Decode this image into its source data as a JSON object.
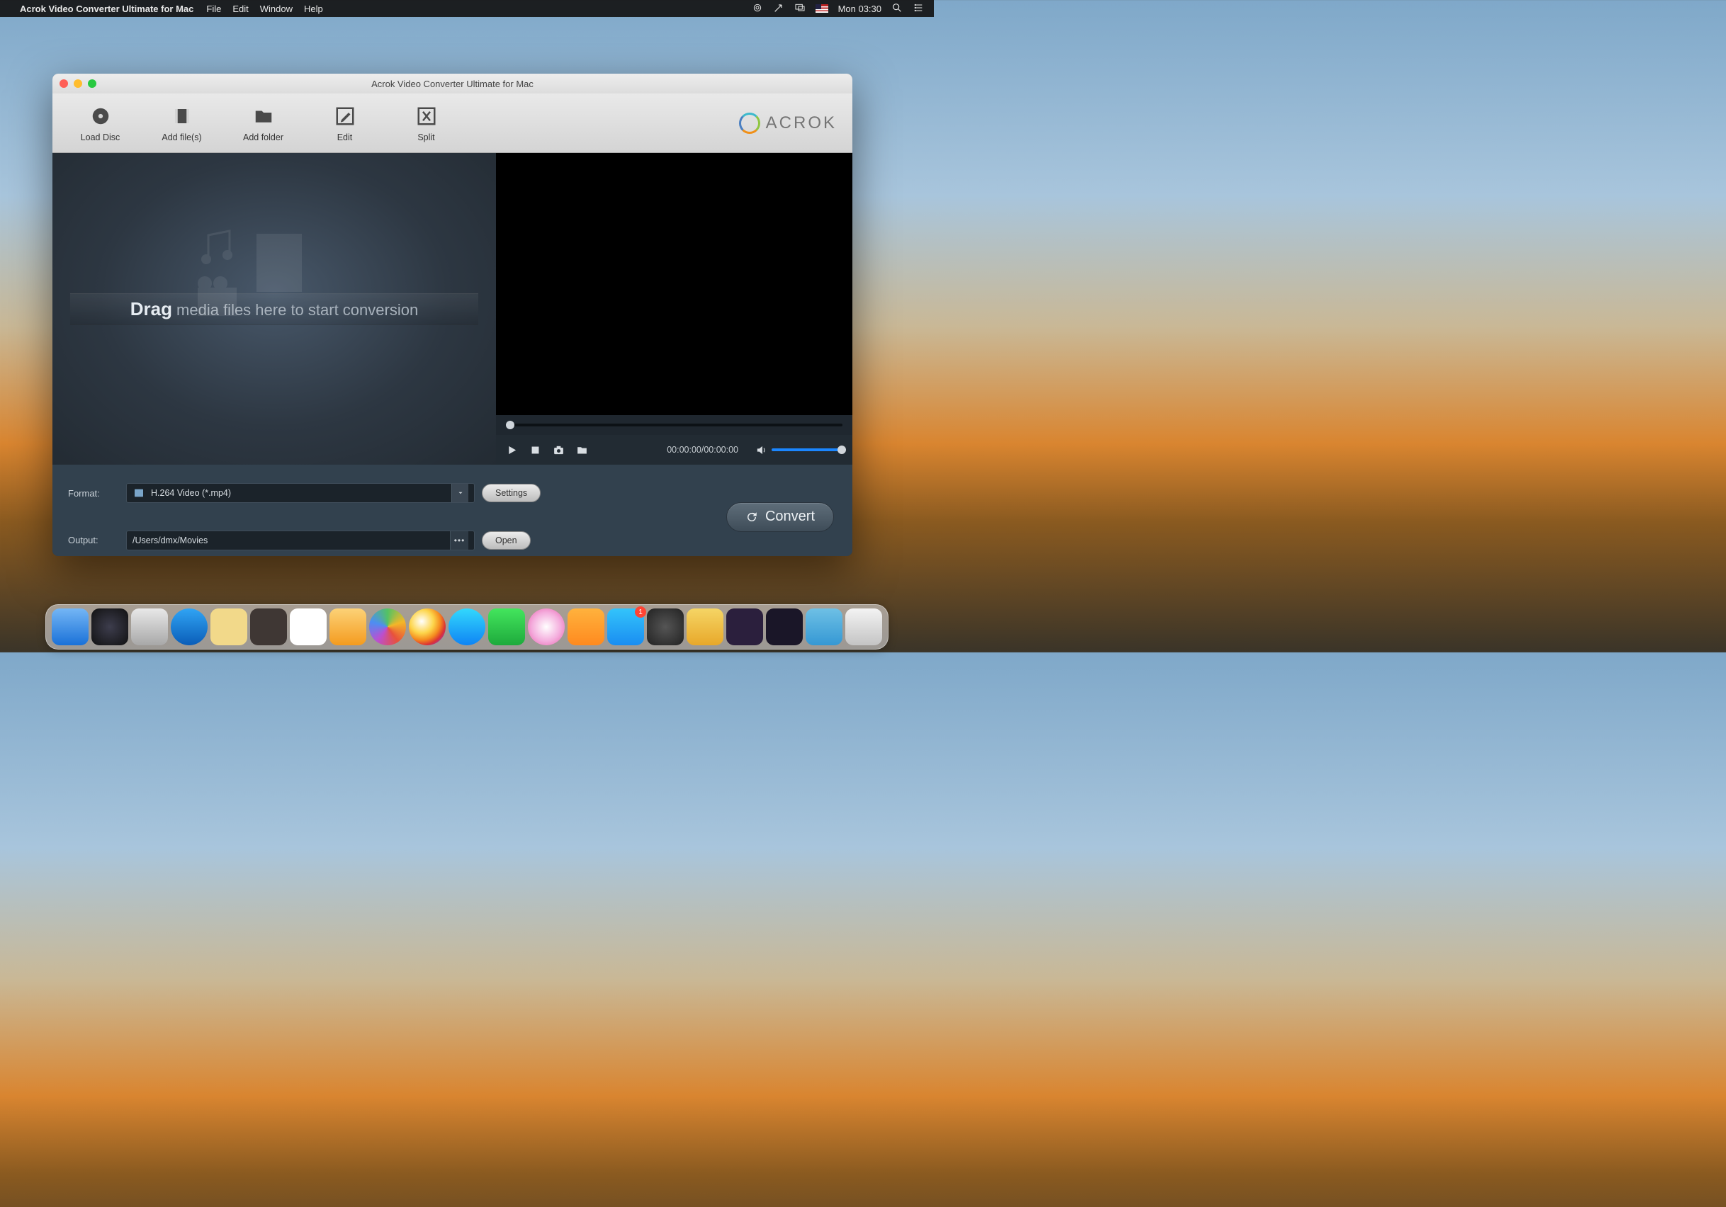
{
  "menubar": {
    "app_name": "Acrok Video Converter Ultimate for Mac",
    "items": [
      "File",
      "Edit",
      "Window",
      "Help"
    ],
    "clock": "Mon 03:30"
  },
  "window": {
    "title": "Acrok Video Converter Ultimate for Mac",
    "brand": "ACROK",
    "toolbar": [
      {
        "label": "Load Disc"
      },
      {
        "label": "Add file(s)"
      },
      {
        "label": "Add folder"
      },
      {
        "label": "Edit"
      },
      {
        "label": "Split"
      }
    ],
    "dropzone": {
      "strong": "Drag",
      "rest": "media files here to start conversion"
    },
    "player": {
      "timecode": "00:00:00/00:00:00"
    },
    "bottom": {
      "format_label": "Format:",
      "format_value": "H.264 Video (*.mp4)",
      "settings": "Settings",
      "output_label": "Output:",
      "output_value": "/Users/dmx/Movies",
      "open": "Open",
      "convert": "Convert"
    }
  },
  "dock": {
    "badge": "1"
  }
}
